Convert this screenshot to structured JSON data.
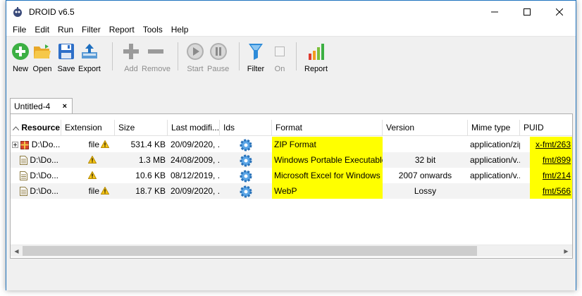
{
  "window": {
    "title": "DROID v6.5"
  },
  "menu": [
    "File",
    "Edit",
    "Run",
    "Filter",
    "Report",
    "Tools",
    "Help"
  ],
  "toolbar": {
    "new": "New",
    "open": "Open",
    "save": "Save",
    "export": "Export",
    "add": "Add",
    "remove": "Remove",
    "start": "Start",
    "pause": "Pause",
    "filter": "Filter",
    "on": "On",
    "report": "Report"
  },
  "tab": {
    "label": "Untitled-4",
    "close": "×"
  },
  "columns": [
    "Resource",
    "Extension",
    "Size",
    "Last modifi...",
    "Ids",
    "Format",
    "Version",
    "Mime type",
    "PUID"
  ],
  "rows": [
    {
      "resource": "D:\\Do...",
      "extension": "file",
      "size": "531.4 KB",
      "modified": "20/09/2020, ...",
      "format": "ZIP Format",
      "version": "",
      "mime": "application/zip",
      "puid": "x-fmt/263"
    },
    {
      "resource": "D:\\Do...",
      "extension": "",
      "size": "1.3 MB",
      "modified": "24/08/2009, ...",
      "format": "Windows Portable Executable",
      "version": "32 bit",
      "mime": "application/v...",
      "puid": "fmt/899"
    },
    {
      "resource": "D:\\Do...",
      "extension": "",
      "size": "10.6 KB",
      "modified": "08/12/2019, ...",
      "format": "Microsoft Excel for Windows",
      "version": "2007 onwards",
      "mime": "application/v...",
      "puid": "fmt/214"
    },
    {
      "resource": "D:\\Do...",
      "extension": "file",
      "size": "18.7 KB",
      "modified": "20/09/2020, ...",
      "format": "WebP",
      "version": "Lossy",
      "mime": "",
      "puid": "fmt/566"
    }
  ],
  "colors": {
    "highlight": "#ffff00",
    "window_border": "#1e73be",
    "new_icon": "#3cb043",
    "filter_icon": "#2e8bd8"
  }
}
